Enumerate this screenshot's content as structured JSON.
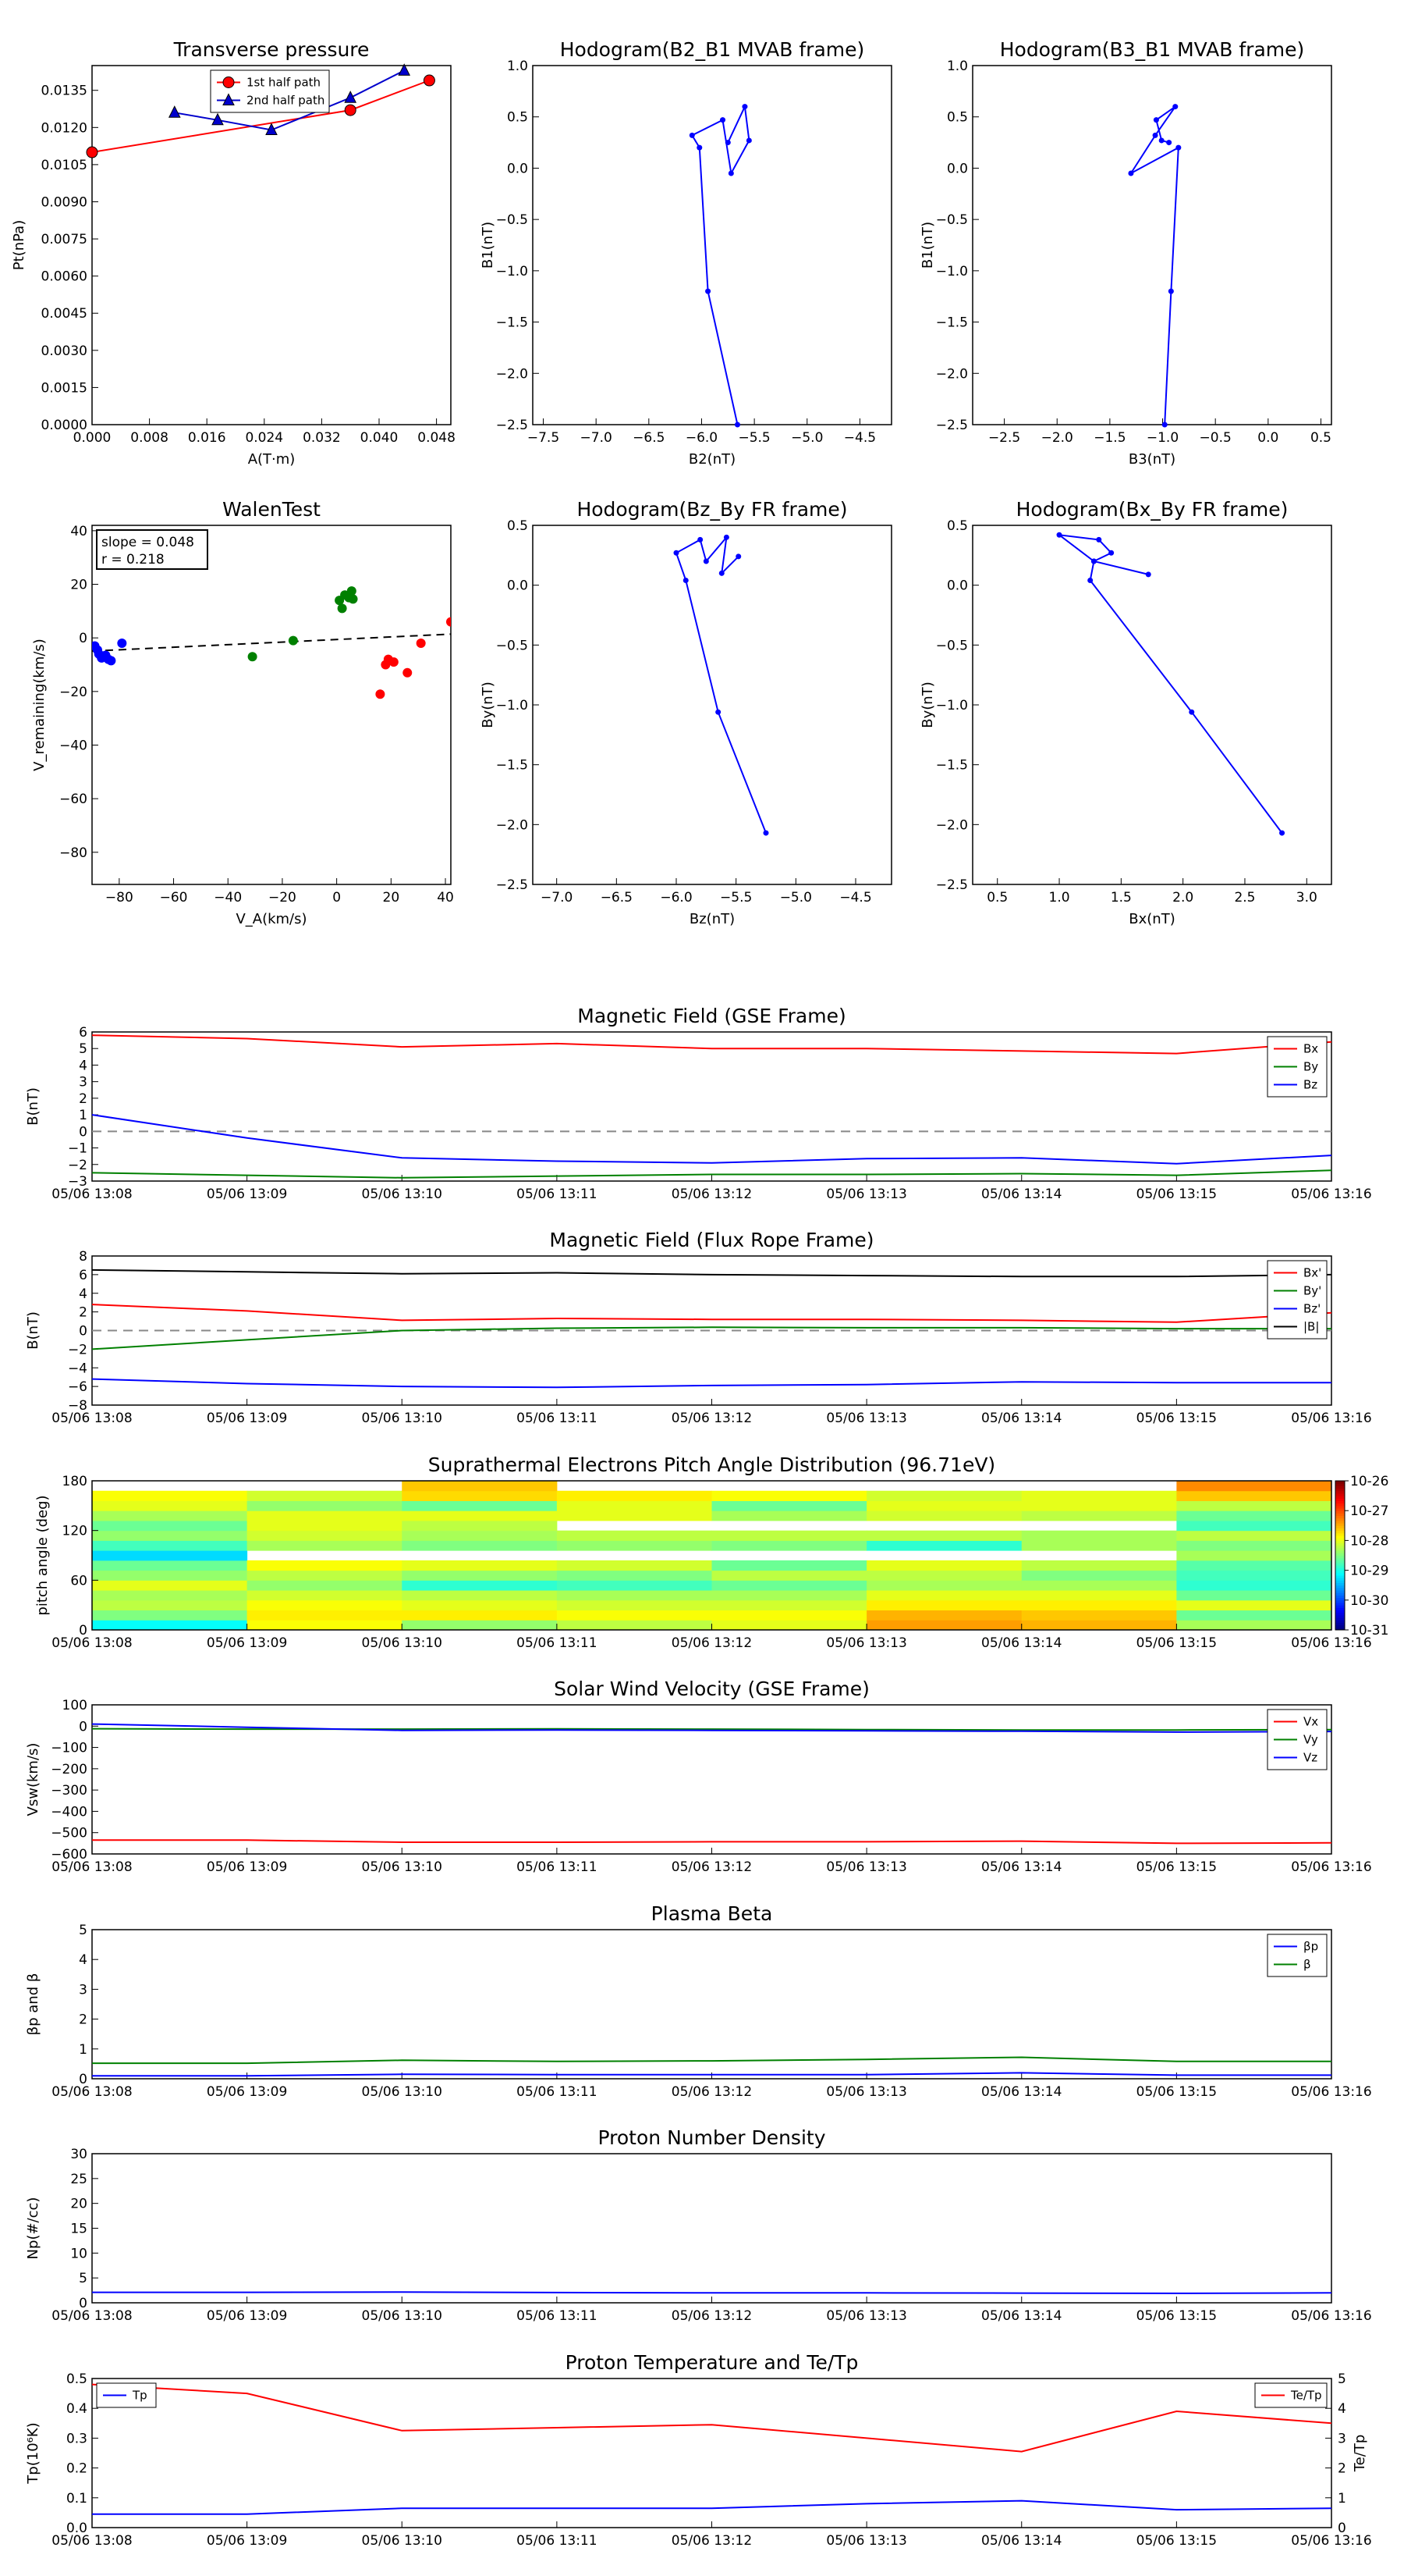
{
  "time_ticks": [
    "05/06 13:08",
    "05/06 13:09",
    "05/06 13:10",
    "05/06 13:11",
    "05/06 13:12",
    "05/06 13:13",
    "05/06 13:14",
    "05/06 13:15",
    "05/06 13:16"
  ],
  "chart_data": [
    {
      "id": "transverse-pressure",
      "type": "line",
      "title": "Transverse pressure",
      "xlabel": "A(T·m)",
      "ylabel": "Pt(nPa)",
      "xlim": [
        0,
        0.05
      ],
      "ylim": [
        0,
        0.0145
      ],
      "xticks": [
        "0.000",
        "0.008",
        "0.016",
        "0.024",
        "0.032",
        "0.040",
        "0.048"
      ],
      "yticks": [
        "0.0000",
        "0.0015",
        "0.0030",
        "0.0045",
        "0.0060",
        "0.0075",
        "0.0090",
        "0.0105",
        "0.0120",
        "0.0135"
      ],
      "legend": "top-center",
      "series": [
        {
          "name": "1st half path",
          "color": "#ff0000",
          "marker": "circle",
          "x": [
            0.0,
            0.036,
            0.047
          ],
          "y": [
            0.011,
            0.0127,
            0.0139
          ]
        },
        {
          "name": "2nd half path",
          "color": "#0000cc",
          "marker": "triangle",
          "x": [
            0.0115,
            0.0175,
            0.025,
            0.036,
            0.0435
          ],
          "y": [
            0.0126,
            0.0123,
            0.0119,
            0.0132,
            0.0143
          ]
        }
      ]
    },
    {
      "id": "hodogram-b2-b1",
      "type": "line",
      "title": "Hodogram(B2_B1 MVAB frame)",
      "xlabel": "B2(nT)",
      "ylabel": "B1(nT)",
      "xlim": [
        -7.6,
        -4.2
      ],
      "ylim": [
        -2.5,
        1.0
      ],
      "xticks": [
        "−7.5",
        "−7.0",
        "−6.5",
        "−6.0",
        "−5.5",
        "−5.0",
        "−4.5"
      ],
      "yticks": [
        "−2.5",
        "−2.0",
        "−1.5",
        "−1.0",
        "−0.5",
        "0.0",
        "0.5",
        "1.0"
      ],
      "series": [
        {
          "name": "",
          "color": "#0000ff",
          "marker": "dot",
          "x": [
            -5.66,
            -5.94,
            -6.02,
            -6.09,
            -5.8,
            -5.72,
            -5.55,
            -5.59,
            -5.75
          ],
          "y": [
            -2.5,
            -1.2,
            0.2,
            0.32,
            0.47,
            -0.05,
            0.27,
            0.6,
            0.25
          ]
        }
      ]
    },
    {
      "id": "hodogram-b3-b1",
      "type": "line",
      "title": "Hodogram(B3_B1 MVAB frame)",
      "xlabel": "B3(nT)",
      "ylabel": "B1(nT)",
      "xlim": [
        -2.8,
        0.6
      ],
      "ylim": [
        -2.5,
        1.0
      ],
      "xticks": [
        "−2.5",
        "−2.0",
        "−1.5",
        "−1.0",
        "−0.5",
        "0.0",
        "0.5"
      ],
      "yticks": [
        "−2.5",
        "−2.0",
        "−1.5",
        "−1.0",
        "−0.5",
        "0.0",
        "0.5",
        "1.0"
      ],
      "series": [
        {
          "name": "",
          "color": "#0000ff",
          "marker": "dot",
          "x": [
            -0.98,
            -0.92,
            -0.85,
            -1.3,
            -1.07,
            -0.88,
            -1.06,
            -1.01,
            -0.94
          ],
          "y": [
            -2.5,
            -1.2,
            0.2,
            -0.05,
            0.32,
            0.6,
            0.47,
            0.27,
            0.25
          ]
        }
      ]
    },
    {
      "id": "walen-test",
      "type": "scatter",
      "title": "WalenTest",
      "xlabel": "V_A(km/s)",
      "ylabel": "V_remaining(km/s)",
      "xlim": [
        -90,
        42
      ],
      "ylim": [
        -92,
        42
      ],
      "xticks": [
        "−80",
        "−60",
        "−40",
        "−20",
        "0",
        "20",
        "40"
      ],
      "yticks": [
        "−80",
        "−60",
        "−40",
        "−20",
        "0",
        "20",
        "40"
      ],
      "annotation": [
        "slope = 0.048",
        "r = 0.218"
      ],
      "fit": {
        "slope": 0.048,
        "intercept": -0.6,
        "color": "#000000"
      },
      "series": [
        {
          "name": "",
          "color": "#0000ff",
          "x": [
            -89,
            -88,
            -87.5,
            -86.5,
            -85,
            -84,
            -83,
            -79
          ],
          "y": [
            -3,
            -4.5,
            -6,
            -7.5,
            -6.5,
            -8,
            -8.5,
            -2
          ]
        },
        {
          "name": "",
          "color": "#008000",
          "x": [
            -31,
            -16,
            1,
            2,
            3,
            4.5,
            5.5,
            6
          ],
          "y": [
            -7,
            -1,
            14,
            11,
            16,
            15,
            17.5,
            14.5
          ]
        },
        {
          "name": "",
          "color": "#ff0000",
          "x": [
            16,
            18,
            19,
            21,
            26,
            31,
            42
          ],
          "y": [
            -21,
            -10,
            -8,
            -9,
            -13,
            -2,
            6
          ]
        }
      ]
    },
    {
      "id": "hodogram-bz-by",
      "type": "line",
      "title": "Hodogram(Bz_By FR frame)",
      "xlabel": "Bz(nT)",
      "ylabel": "By(nT)",
      "xlim": [
        -7.2,
        -4.2
      ],
      "ylim": [
        -2.5,
        0.5
      ],
      "xticks": [
        "−7.0",
        "−6.5",
        "−6.0",
        "−5.5",
        "−5.0",
        "−4.5"
      ],
      "yticks": [
        "−2.5",
        "−2.0",
        "−1.5",
        "−1.0",
        "−0.5",
        "0.0",
        "0.5"
      ],
      "series": [
        {
          "name": "",
          "color": "#0000ff",
          "marker": "dot",
          "x": [
            -5.25,
            -5.65,
            -5.92,
            -6.0,
            -5.8,
            -5.75,
            -5.58,
            -5.62,
            -5.48
          ],
          "y": [
            -2.07,
            -1.06,
            0.04,
            0.27,
            0.38,
            0.2,
            0.4,
            0.1,
            0.24
          ]
        }
      ]
    },
    {
      "id": "hodogram-bx-by",
      "type": "line",
      "title": "Hodogram(Bx_By FR frame)",
      "xlabel": "Bx(nT)",
      "ylabel": "By(nT)",
      "xlim": [
        0.3,
        3.2
      ],
      "ylim": [
        -2.5,
        0.5
      ],
      "xticks": [
        "0.5",
        "1.0",
        "1.5",
        "2.0",
        "2.5",
        "3.0"
      ],
      "yticks": [
        "−2.5",
        "−2.0",
        "−1.5",
        "−1.0",
        "−0.5",
        "0.0",
        "0.5"
      ],
      "series": [
        {
          "name": "",
          "color": "#0000ff",
          "marker": "dot",
          "x": [
            2.8,
            2.07,
            1.25,
            1.28,
            1.42,
            1.32,
            1.0,
            1.28,
            1.72
          ],
          "y": [
            -2.07,
            -1.06,
            0.04,
            0.2,
            0.27,
            0.38,
            0.42,
            0.2,
            0.09
          ]
        }
      ]
    },
    {
      "id": "magnetic-field-gse",
      "type": "line",
      "title": "Magnetic Field (GSE Frame)",
      "ylabel": "B(nT)",
      "ylim": [
        -3,
        6
      ],
      "yticks": [
        "−3",
        "−2",
        "−1",
        "0",
        "1",
        "2",
        "3",
        "4",
        "5",
        "6"
      ],
      "xlim": [
        0,
        8
      ],
      "zero_line": true,
      "legend": "top-right",
      "series": [
        {
          "name": "Bx",
          "color": "#ff0000",
          "x": [
            0,
            1,
            2,
            3,
            4,
            5,
            6,
            7,
            8
          ],
          "y": [
            5.8,
            5.6,
            5.1,
            5.3,
            5.0,
            5.0,
            4.85,
            4.7,
            5.4
          ]
        },
        {
          "name": "By",
          "color": "#008000",
          "x": [
            0,
            1,
            2,
            3,
            4,
            5,
            6,
            7,
            8
          ],
          "y": [
            -2.5,
            -2.65,
            -2.8,
            -2.7,
            -2.6,
            -2.6,
            -2.55,
            -2.65,
            -2.35
          ]
        },
        {
          "name": "Bz",
          "color": "#0000ff",
          "x": [
            0,
            1,
            2,
            3,
            4,
            5,
            6,
            7,
            8
          ],
          "y": [
            1.0,
            -0.4,
            -1.6,
            -1.8,
            -1.9,
            -1.65,
            -1.6,
            -1.95,
            -1.45
          ]
        }
      ]
    },
    {
      "id": "magnetic-field-fr",
      "type": "line",
      "title": "Magnetic Field (Flux Rope Frame)",
      "ylabel": "B(nT)",
      "ylim": [
        -8,
        8
      ],
      "yticks": [
        "−8",
        "−6",
        "−4",
        "−2",
        "0",
        "2",
        "4",
        "6",
        "8"
      ],
      "xlim": [
        0,
        8
      ],
      "zero_line": true,
      "legend": "top-right",
      "series": [
        {
          "name": "Bx'",
          "color": "#ff0000",
          "x": [
            0,
            1,
            2,
            3,
            4,
            5,
            6,
            7,
            8
          ],
          "y": [
            2.8,
            2.1,
            1.1,
            1.3,
            1.2,
            1.2,
            1.1,
            0.9,
            1.9
          ]
        },
        {
          "name": "By'",
          "color": "#008000",
          "x": [
            0,
            1,
            2,
            3,
            4,
            5,
            6,
            7,
            8
          ],
          "y": [
            -2.0,
            -1.0,
            0.0,
            0.25,
            0.35,
            0.3,
            0.3,
            0.2,
            0.2
          ]
        },
        {
          "name": "Bz'",
          "color": "#0000ff",
          "x": [
            0,
            1,
            2,
            3,
            4,
            5,
            6,
            7,
            8
          ],
          "y": [
            -5.2,
            -5.7,
            -6.0,
            -6.1,
            -5.9,
            -5.8,
            -5.5,
            -5.6,
            -5.6
          ]
        },
        {
          "name": "|B|",
          "color": "#000000",
          "x": [
            0,
            1,
            2,
            3,
            4,
            5,
            6,
            7,
            8
          ],
          "y": [
            6.5,
            6.3,
            6.1,
            6.2,
            6.0,
            5.9,
            5.8,
            5.8,
            6.0
          ]
        }
      ]
    },
    {
      "id": "suprathermal-electrons-pad",
      "type": "heatmap",
      "title": "Suprathermal Electrons Pitch Angle Distribution (96.71eV)",
      "ylabel": "pitch angle (deg)",
      "ylim": [
        0,
        180
      ],
      "yticks": [
        "0",
        "60",
        "120",
        "180"
      ],
      "xlim": [
        0,
        8
      ],
      "colorbar_ticks": [
        "10-26",
        "10-27",
        "10-28",
        "10-29",
        "10-30",
        "10-31"
      ],
      "colorbar_range": [
        -31,
        -26
      ],
      "bins": [
        0,
        12,
        24,
        36,
        48,
        60,
        72,
        84,
        96,
        108,
        120,
        132,
        144,
        156,
        168,
        180
      ],
      "columns": [
        [
          -29.1,
          -28.5,
          -28.2,
          -28.3,
          -28.0,
          -28.4,
          -28.6,
          -29.3,
          -28.8,
          -28.4,
          -28.6,
          -28.3,
          -28.0,
          -27.9,
          null
        ],
        [
          -27.9,
          -27.8,
          -27.9,
          -28.1,
          -28.4,
          -28.2,
          -27.9,
          null,
          -28.3,
          -28.1,
          -28.0,
          -28.0,
          -28.4,
          -28.1,
          null
        ],
        [
          -28.4,
          -27.8,
          -28.0,
          -28.2,
          -28.9,
          -28.4,
          -28.0,
          null,
          -28.5,
          -28.3,
          -28.2,
          -28.0,
          -28.6,
          -27.7,
          -27.6
        ],
        [
          -28.2,
          -27.9,
          -28.1,
          -28.3,
          -28.8,
          -28.5,
          -28.1,
          null,
          -28.4,
          -28.2,
          null,
          -28.0,
          -28.0,
          -27.8,
          null
        ],
        [
          -28.0,
          -27.9,
          -28.1,
          -28.3,
          -28.6,
          -28.2,
          -28.6,
          null,
          -28.5,
          -28.2,
          null,
          -28.3,
          -28.6,
          -27.9,
          null
        ],
        [
          -27.4,
          -27.5,
          -27.8,
          -28.0,
          -28.3,
          -28.2,
          -28.0,
          null,
          -28.9,
          -28.2,
          null,
          -28.1,
          -28.0,
          -28.1,
          null
        ],
        [
          -27.5,
          -27.6,
          -27.8,
          -28.0,
          -28.3,
          -28.5,
          -28.2,
          null,
          -28.3,
          -28.3,
          null,
          -28.2,
          -28.0,
          -28.0,
          null
        ],
        [
          -28.3,
          -28.6,
          -28.0,
          -28.6,
          -28.9,
          -28.8,
          -28.7,
          -28.3,
          -28.5,
          -28.2,
          -28.8,
          -28.6,
          -28.2,
          -27.6,
          -27.3
        ]
      ]
    },
    {
      "id": "solar-wind-velocity",
      "type": "line",
      "title": "Solar Wind Velocity (GSE Frame)",
      "ylabel": "Vsw(km/s)",
      "ylim": [
        -600,
        100
      ],
      "yticks": [
        "−600",
        "−500",
        "−400",
        "−300",
        "−200",
        "−100",
        "0",
        "100"
      ],
      "xlim": [
        0,
        8
      ],
      "legend": "top-right",
      "series": [
        {
          "name": "Vx",
          "color": "#ff0000",
          "x": [
            0,
            1,
            2,
            3,
            4,
            5,
            6,
            7,
            8
          ],
          "y": [
            -535,
            -535,
            -545,
            -545,
            -543,
            -543,
            -540,
            -550,
            -548
          ]
        },
        {
          "name": "Vy",
          "color": "#008000",
          "x": [
            0,
            1,
            2,
            3,
            4,
            5,
            6,
            7,
            8
          ],
          "y": [
            -12,
            -14,
            -14,
            -13,
            -14,
            -16,
            -18,
            -18,
            -16
          ]
        },
        {
          "name": "Vz",
          "color": "#0000ff",
          "x": [
            0,
            1,
            2,
            3,
            4,
            5,
            6,
            7,
            8
          ],
          "y": [
            10,
            -5,
            -20,
            -18,
            -20,
            -22,
            -24,
            -28,
            -25
          ]
        }
      ]
    },
    {
      "id": "plasma-beta",
      "type": "line",
      "title": "Plasma Beta",
      "ylabel": "βp and β",
      "ylim": [
        0,
        5
      ],
      "yticks": [
        "0",
        "1",
        "2",
        "3",
        "4",
        "5"
      ],
      "xlim": [
        0,
        8
      ],
      "legend": "top-right",
      "series": [
        {
          "name": "βp",
          "color": "#0000ff",
          "x": [
            0,
            1,
            2,
            3,
            4,
            5,
            6,
            7,
            8
          ],
          "y": [
            0.1,
            0.1,
            0.15,
            0.14,
            0.14,
            0.14,
            0.2,
            0.12,
            0.12
          ]
        },
        {
          "name": "β",
          "color": "#008000",
          "x": [
            0,
            1,
            2,
            3,
            4,
            5,
            6,
            7,
            8
          ],
          "y": [
            0.52,
            0.52,
            0.62,
            0.58,
            0.6,
            0.65,
            0.72,
            0.58,
            0.58
          ]
        }
      ]
    },
    {
      "id": "proton-number-density",
      "type": "line",
      "title": "Proton Number Density",
      "ylabel": "Np(#/cc)",
      "ylim": [
        0,
        30
      ],
      "yticks": [
        "0",
        "5",
        "10",
        "15",
        "20",
        "25",
        "30"
      ],
      "xlim": [
        0,
        8
      ],
      "series": [
        {
          "name": "",
          "color": "#0000ff",
          "x": [
            0,
            1,
            2,
            3,
            4,
            5,
            6,
            7,
            8
          ],
          "y": [
            2.1,
            2.1,
            2.15,
            2.05,
            2.0,
            2.0,
            1.95,
            1.9,
            2.0
          ]
        }
      ]
    },
    {
      "id": "proton-temperature",
      "type": "line",
      "title": "Proton Temperature and Te/Tp",
      "ylabel": "Tp(10⁶K)",
      "ylabel_right": "Te/Tp",
      "ylim": [
        0,
        0.5
      ],
      "ylim_right": [
        0,
        5
      ],
      "yticks": [
        "0.0",
        "0.1",
        "0.2",
        "0.3",
        "0.4",
        "0.5"
      ],
      "yticks_right": [
        "0",
        "1",
        "2",
        "3",
        "4",
        "5"
      ],
      "xlim": [
        0,
        8
      ],
      "legend": "top-left / top-right",
      "series": [
        {
          "name": "Tp",
          "color": "#0000ff",
          "axis": "left",
          "x": [
            0,
            1,
            2,
            3,
            4,
            5,
            6,
            7,
            8
          ],
          "y": [
            0.045,
            0.045,
            0.065,
            0.065,
            0.065,
            0.08,
            0.09,
            0.06,
            0.065
          ]
        },
        {
          "name": "Te/Tp",
          "color": "#ff0000",
          "axis": "right",
          "x": [
            0,
            1,
            2,
            3,
            4,
            5,
            6,
            7,
            8
          ],
          "y": [
            4.8,
            4.5,
            3.25,
            3.35,
            3.45,
            3.0,
            2.55,
            3.9,
            3.5
          ]
        }
      ]
    }
  ]
}
